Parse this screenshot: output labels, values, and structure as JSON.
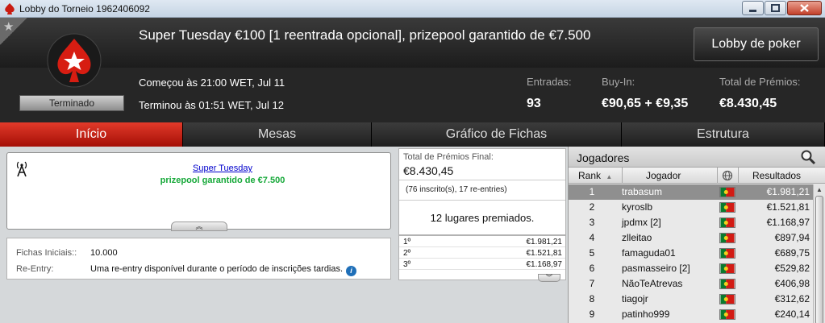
{
  "window": {
    "title": "Lobby do Torneio 1962406092"
  },
  "header": {
    "tournament_name": "Super Tuesday €100 [1 reentrada opcional], prizepool garantido de €7.500",
    "status": "Terminado",
    "started": "Começou às 21:00 WET, Jul 11",
    "ended": "Terminou às 01:51 WET, Jul 12",
    "lobby_button": "Lobby de poker",
    "entries_label": "Entradas:",
    "entries_value": "93",
    "buyin_label": "Buy-In:",
    "buyin_value": "€90,65 + €9,35",
    "prize_label": "Total de Prémios:",
    "prize_value": "€8.430,45"
  },
  "tabs": [
    {
      "label": "Início",
      "active": true
    },
    {
      "label": "Mesas",
      "active": false
    },
    {
      "label": "Gráfico de Fichas",
      "active": false
    },
    {
      "label": "Estrutura",
      "active": false
    }
  ],
  "info": {
    "link": "Super Tuesday",
    "guarantee": "prizepool garantido de €7.500",
    "expander": "︽"
  },
  "details": {
    "starting_chips_label": "Fichas Iniciais::",
    "starting_chips_value": "10.000",
    "reentry_label": "Re-Entry:",
    "reentry_value": "Uma re-entry disponível durante o período de inscrições tardias.",
    "info_glyph": "i"
  },
  "prizes": {
    "final_label": "Total de Prémios Final:",
    "final_value": "€8.430,45",
    "registrations": "(76 inscrito(s), 17 re-entries)",
    "paid_places": "12 lugares premiados.",
    "payouts": [
      {
        "place": "1º",
        "amount": "€1.981,21"
      },
      {
        "place": "2º",
        "amount": "€1.521,81"
      },
      {
        "place": "3º",
        "amount": "€1.168,97"
      }
    ],
    "more": "︾"
  },
  "players": {
    "title": "Jogadores",
    "col_rank": "Rank",
    "sort_glyph": "▲",
    "col_player": "Jogador",
    "col_results": "Resultados",
    "rows": [
      {
        "rank": "1",
        "name": "trabasum",
        "result": "€1.981,21"
      },
      {
        "rank": "2",
        "name": "kyroslb",
        "result": "€1.521,81"
      },
      {
        "rank": "3",
        "name": "jpdmx [2]",
        "result": "€1.168,97"
      },
      {
        "rank": "4",
        "name": "zlleitao",
        "result": "€897,94"
      },
      {
        "rank": "5",
        "name": "famaguda01",
        "result": "€689,75"
      },
      {
        "rank": "6",
        "name": "pasmasseiro [2]",
        "result": "€529,82"
      },
      {
        "rank": "7",
        "name": "NãoTeAtrevas",
        "result": "€406,98"
      },
      {
        "rank": "8",
        "name": "tiagojr",
        "result": "€312,62"
      },
      {
        "rank": "9",
        "name": "patinho999",
        "result": "€240,14"
      }
    ]
  },
  "colors": {
    "accent_red": "#c4170c",
    "header_bg": "#262626",
    "guarantee_green": "#15a838"
  }
}
